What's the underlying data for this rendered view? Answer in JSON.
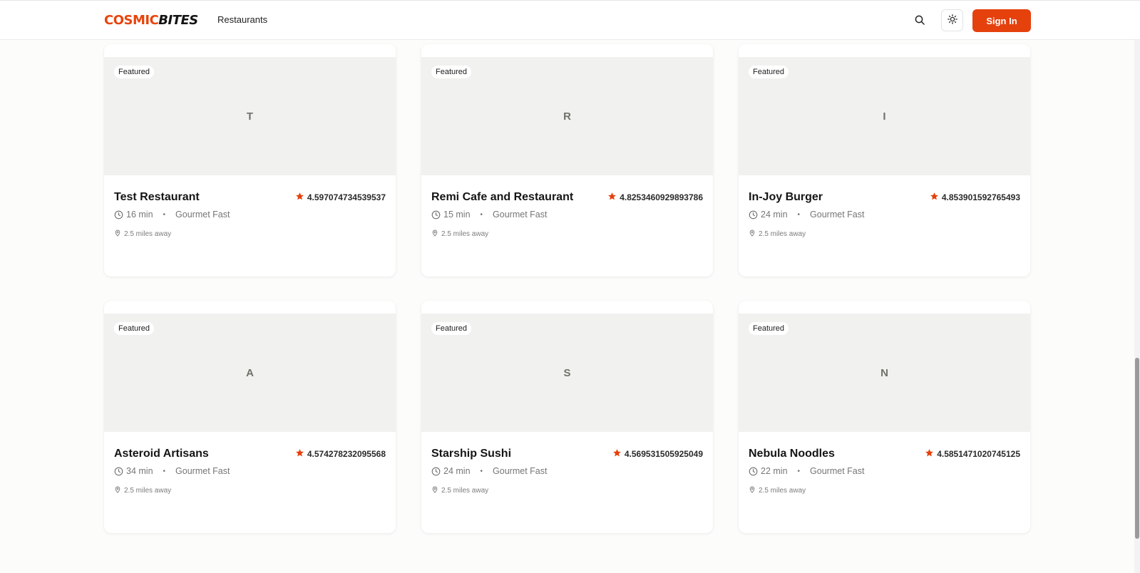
{
  "header": {
    "logo_part1": "COSMIC",
    "logo_part2": "BITES",
    "nav_restaurants": "Restaurants",
    "sign_in": "Sign In",
    "search_icon": "search-icon",
    "theme_icon": "sun-icon"
  },
  "colors": {
    "brand": "#e5410d",
    "star": "#e5410d"
  },
  "restaurants": [
    {
      "badge": "Featured",
      "initial": "T",
      "name": "Test Restaurant",
      "rating": "4.597074734539537",
      "time": "16 min",
      "category": "Gourmet Fast",
      "distance": "2.5 miles away"
    },
    {
      "badge": "Featured",
      "initial": "R",
      "name": "Remi Cafe and Restaurant",
      "rating": "4.8253460929893786",
      "time": "15 min",
      "category": "Gourmet Fast",
      "distance": "2.5 miles away"
    },
    {
      "badge": "Featured",
      "initial": "I",
      "name": "In-Joy Burger",
      "rating": "4.853901592765493",
      "time": "24 min",
      "category": "Gourmet Fast",
      "distance": "2.5 miles away"
    },
    {
      "badge": "Featured",
      "initial": "A",
      "name": "Asteroid Artisans",
      "rating": "4.574278232095568",
      "time": "34 min",
      "category": "Gourmet Fast",
      "distance": "2.5 miles away"
    },
    {
      "badge": "Featured",
      "initial": "S",
      "name": "Starship Sushi",
      "rating": "4.569531505925049",
      "time": "24 min",
      "category": "Gourmet Fast",
      "distance": "2.5 miles away"
    },
    {
      "badge": "Featured",
      "initial": "N",
      "name": "Nebula Noodles",
      "rating": "4.5851471020745125",
      "time": "22 min",
      "category": "Gourmet Fast",
      "distance": "2.5 miles away"
    }
  ]
}
